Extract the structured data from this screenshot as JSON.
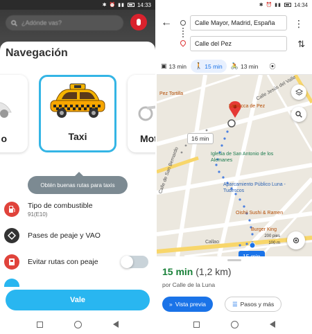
{
  "left": {
    "status_time": "14:33",
    "search_placeholder": "¿Adónde vas?",
    "title": "Navegación",
    "vehicles": [
      {
        "label": "o"
      },
      {
        "label": "Taxi"
      },
      {
        "label": "Mot"
      }
    ],
    "tooltip": "Obtén buenas rutas para taxis",
    "options": [
      {
        "title": "Tipo de combustible",
        "subtitle": "91(E10)",
        "icon": "gas-pump-icon",
        "color": "#e0433b"
      },
      {
        "title": "Pases de peaje y VAO",
        "subtitle": "",
        "icon": "toll-diamond-icon",
        "color": "#333333"
      },
      {
        "title": "Evitar rutas con peaje",
        "subtitle": "",
        "icon": "toll-avoid-icon",
        "color": "#e0433b"
      }
    ],
    "button": "Vale",
    "accent": "#29b6f0"
  },
  "right": {
    "status_time": "14:34",
    "origin": "Calle Mayor, Madrid, España",
    "destination": "Calle del Pez",
    "modes": [
      {
        "icon": "car-icon",
        "time": "13 min"
      },
      {
        "icon": "walk-icon",
        "time": "15 min"
      },
      {
        "icon": "bike-icon",
        "time": "13 min"
      }
    ],
    "map": {
      "bubble_alt": "16 min",
      "bubble_main": "15 min",
      "labels": {
        "pez_tortilla": "Pez Tortilla",
        "lamucca": "Lamucca de Pez",
        "iglesia": "Iglesia de San Antonio de los Alemanes",
        "aparcamiento": "Aparcamiento Público Luna - Tudescos",
        "oishii": "Oishii Sushi & Ramen",
        "burger": "Burger King",
        "callao": "Callao",
        "san_bernardo": "Calle de San Bernardo",
        "calle_luna": "Calle de la Luna",
        "calle_jesus": "Calle Jesús del Valle"
      },
      "scale_ft": "200 pies",
      "scale_m": "100 m"
    },
    "trip_time": "15 min",
    "trip_dist": "(1,2 km)",
    "via": "por Calle de la Luna",
    "btn_preview": "Vista previa",
    "btn_steps": "Pasos y más",
    "accent": "#1a73e8"
  }
}
